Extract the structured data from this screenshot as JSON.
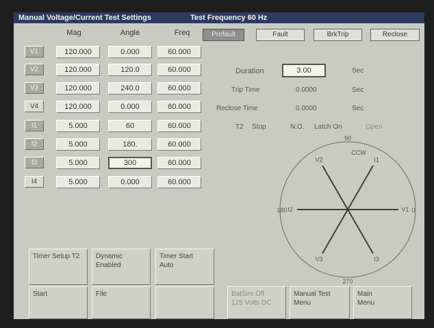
{
  "titlebar": {
    "settings_title": "Manual Voltage/Current Test Settings",
    "frequency_title": "Test Frequency 60 Hz"
  },
  "columns": {
    "mag": "Mag",
    "angle": "Angle",
    "freq": "Freq"
  },
  "modes": {
    "prefault": "Prefault",
    "fault": "Fault",
    "brktrip": "BrkTrip",
    "reclose": "Reclose",
    "active": "Prefault"
  },
  "channels": [
    {
      "label": "V1",
      "mag": "120.000",
      "angle": "0.000",
      "freq": "60.000"
    },
    {
      "label": "V2",
      "mag": "120.000",
      "angle": "120.0",
      "freq": "60.000"
    },
    {
      "label": "V3",
      "mag": "120.000",
      "angle": "240.0",
      "freq": "60.000"
    },
    {
      "label": "V4",
      "mag": "120.000",
      "angle": "0.000",
      "freq": "60.000"
    },
    {
      "label": "I1",
      "mag": "5.000",
      "angle": "60",
      "freq": "60.000"
    },
    {
      "label": "I2",
      "mag": "5.000",
      "angle": "180.",
      "freq": "60.000"
    },
    {
      "label": "I3",
      "mag": "5.000",
      "angle": "300",
      "freq": "60.000"
    },
    {
      "label": "I4",
      "mag": "5.000",
      "angle": "0.000",
      "freq": "60.000"
    }
  ],
  "timing": {
    "duration_label": "Duration",
    "duration_value": "3.00",
    "duration_unit": "Sec",
    "trip_label": "Trip Time",
    "trip_value": "0.0000",
    "trip_unit": "Sec",
    "reclose_label": "Reclose Time",
    "reclose_value": "0.0000",
    "reclose_unit": "Sec"
  },
  "status": {
    "t2": "T2",
    "stop": "Stop",
    "no": "N.O.",
    "latch": "Latch On",
    "open": "Open"
  },
  "phasor": {
    "tick_90": "90",
    "tick_0": "0",
    "tick_180": "180",
    "tick_270": "270",
    "rotation": "CCW",
    "vectors": [
      {
        "label": "V1",
        "angle": 0,
        "magnitude": 1.0
      },
      {
        "label": "V2",
        "angle": 120,
        "magnitude": 1.0
      },
      {
        "label": "V3",
        "angle": 240,
        "magnitude": 1.0
      },
      {
        "label": "I1",
        "angle": 60,
        "magnitude": 1.0
      },
      {
        "label": "I2",
        "angle": 180,
        "magnitude": 1.0
      },
      {
        "label": "I3",
        "angle": 300,
        "magnitude": 1.0
      }
    ]
  },
  "softkeys": {
    "timer_setup": "Timer Setup T2",
    "dynamic_1": "Dynamic",
    "dynamic_2": "Enabled",
    "timer_start_1": "Timer Start",
    "timer_start_2": "Auto",
    "start": "Start",
    "file": "File",
    "batsim_1": "BatSim Off",
    "batsim_2": "125 Volts DC",
    "manual_1": "Manual Test",
    "manual_2": "Menu",
    "main_1": "Main",
    "main_2": "Menu"
  }
}
